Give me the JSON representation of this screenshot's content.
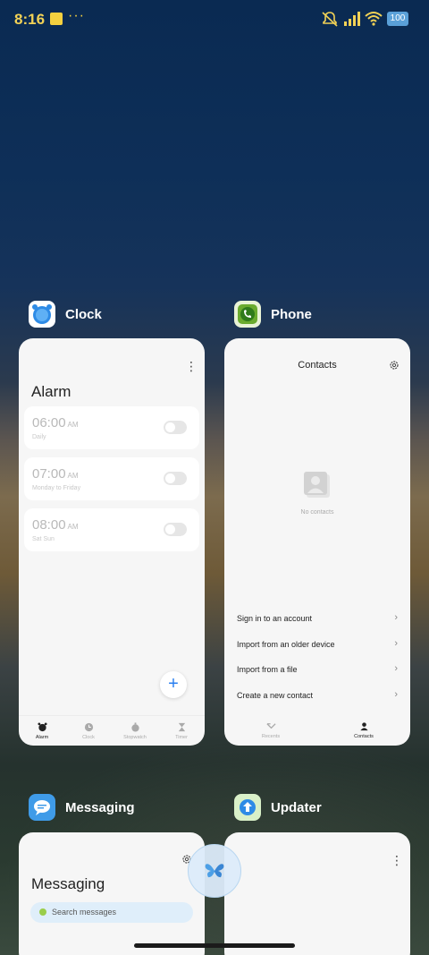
{
  "status_bar": {
    "time": "8:16",
    "battery": "100"
  },
  "apps": {
    "clock": {
      "name": "Clock",
      "title": "Alarm",
      "alarms": [
        {
          "time": "06:00",
          "ampm": "AM",
          "repeat": "Daily",
          "enabled": false
        },
        {
          "time": "07:00",
          "ampm": "AM",
          "repeat": "Monday to Friday",
          "enabled": false
        },
        {
          "time": "08:00",
          "ampm": "AM",
          "repeat": "Sat Sun",
          "enabled": false
        }
      ],
      "fab_label": "+",
      "nav": [
        "Alarm",
        "Clock",
        "Stopwatch",
        "Timer"
      ],
      "nav_active": "Alarm"
    },
    "phone": {
      "name": "Phone",
      "title": "Contacts",
      "empty_text": "No contacts",
      "actions": [
        "Sign in to an account",
        "Import from an older device",
        "Import from a file",
        "Create a new contact"
      ],
      "nav": [
        "Recents",
        "Contacts"
      ],
      "nav_active": "Contacts"
    },
    "messaging": {
      "name": "Messaging",
      "title": "Messaging",
      "search_placeholder": "Search messages"
    },
    "updater": {
      "name": "Updater"
    }
  },
  "colors": {
    "time": "#f2d256",
    "accent_blue": "#2a7ff0",
    "battery": "#5aa0d8"
  }
}
